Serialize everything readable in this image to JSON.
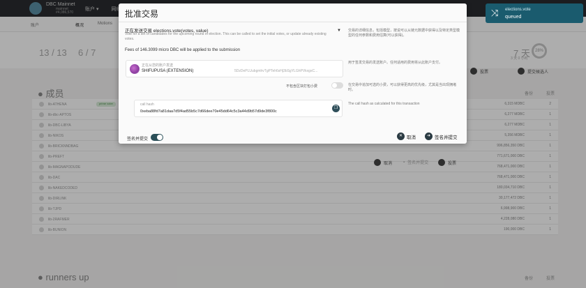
{
  "header": {
    "chain_name": "DBC Mainnet",
    "chain_sub_1": "mainnet",
    "chain_sub_2": "#4,086,570",
    "nav_accounts": "账户 ▾",
    "nav_network": "网络 ▾"
  },
  "toast": {
    "title": "elections.vote",
    "status": "queued"
  },
  "subnav": {
    "back": "账户",
    "tab_active": "概况",
    "tab_motions": "Motions"
  },
  "summary": {
    "seats": "13 / 13",
    "runners": "6 / 7",
    "term_time": "7 天",
    "term_sub": "3 天 0 小时",
    "term_pct": "28%"
  },
  "bg_buttons": {
    "vote": "投票",
    "submit_candidacy": "提交候选人"
  },
  "members": {
    "title": "成员",
    "col_backing": "备份",
    "col_votes": "投票",
    "badge": "prime voter",
    "rows": [
      {
        "name": "lib-ATHENA",
        "bal": "6,315 MDBC",
        "cnt": "2"
      },
      {
        "name": "lib-dbc-APTOS",
        "bal": "6,277 MDBC",
        "cnt": "1"
      },
      {
        "name": "lib-DBC-LIBYA",
        "bal": "6,277 MDBC",
        "cnt": "1"
      },
      {
        "name": "lib-NIKOS",
        "bal": "5,356 MDBC",
        "cnt": "1"
      },
      {
        "name": "lib-BRICKNNDBAG",
        "bal": "996,856,350 DBC",
        "cnt": "1"
      },
      {
        "name": "lib-PREFT",
        "bal": "771,671,000 DBC",
        "cnt": "1"
      },
      {
        "name": "lib-MAGNAPODUDE",
        "bal": "768,471,000 DBC",
        "cnt": "1"
      },
      {
        "name": "lib-DAC",
        "bal": "768,471,000 DBC",
        "cnt": "1"
      },
      {
        "name": "lib-NAKEDCODED",
        "bal": "180,034,710 DBC",
        "cnt": "1"
      },
      {
        "name": "lib-DIRLINK",
        "bal": "30,177,472 DBC",
        "cnt": "1"
      },
      {
        "name": "lib-TJPD",
        "bal": "6,998,900 DBC",
        "cnt": "1"
      },
      {
        "name": "lib-2RAFMER",
        "bal": "4,228,080 DBC",
        "cnt": "1"
      },
      {
        "name": "lib-BUNION",
        "bal": "190,000 DBC",
        "cnt": "1"
      }
    ]
  },
  "runners": {
    "title": "runners up",
    "col_backing": "备份",
    "col_votes": "投票"
  },
  "bg_actions": {
    "cancel": "取消",
    "sign_submit": "签名并提交",
    "vote": "投票"
  },
  "modal": {
    "title": "批准交易",
    "call_main": "正在发送交易 elections.vote(votes, value)",
    "call_desc": "Vote for a set of candidates for the upcoming round of election. This can be called to set the initial votes, or update already existing votes.",
    "call_help": "交易的详细信息，包括模型，按说可以从链元数据中获得以及特定类型模型的任何参数和费用估算(可以获得)。",
    "fees": "Fees of 146.3099 micro DBC will be applied to the submission",
    "account_label": "正在从您的账户发送",
    "account_name": "SHIFUPUSA (EXTENSION)",
    "account_addr": "5DzDePLUubgmhvTgPTeh6sHj3bSgYLGhPVkxgsC...",
    "account_help": "用于签发交易的发送账户。任何适用的费用将从此账户支付。",
    "nonce_label": "不包含区块打包小费",
    "nonce_help": "在交易中追加可选的小费，可以获得更高的优先级，尤其是当出现拥堵时。",
    "hash_label": "call hash",
    "hash_value": "0xeba88fd7a81daa7d5f4ad55b5c7d66dee70e45dd64c5c3a44d9b57d9de3f800c",
    "hash_help": "The call hash as calculated for this transaction",
    "sign_label": "签名并提交",
    "cancel_label": "取消",
    "submit_label": "签名并提交"
  }
}
